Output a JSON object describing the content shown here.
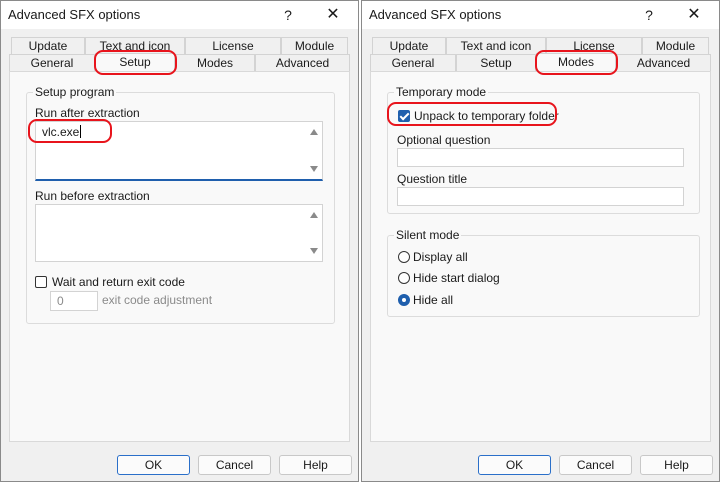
{
  "left_dialog": {
    "title": "Advanced SFX options",
    "help_label": "?",
    "close_label": "✕",
    "tabs_back": [
      "Update",
      "Text and icon",
      "License",
      "Module"
    ],
    "tabs_front": [
      "General",
      "Setup",
      "Modes",
      "Advanced"
    ],
    "selected_tab": "Setup",
    "setup_group_title": "Setup program",
    "run_after_label": "Run after extraction",
    "run_after_value": "vlc.exe",
    "run_before_label": "Run before extraction",
    "run_before_value": "",
    "wait_label": "Wait and return exit code",
    "wait_checked": false,
    "exit_code_value": "0",
    "exit_code_label": "exit code adjustment",
    "ok_label": "OK",
    "cancel_label": "Cancel",
    "help_button_label": "Help"
  },
  "right_dialog": {
    "title": "Advanced SFX options",
    "help_label": "?",
    "close_label": "✕",
    "tabs_back": [
      "Update",
      "Text and icon",
      "License",
      "Module"
    ],
    "tabs_front": [
      "General",
      "Setup",
      "Modes",
      "Advanced"
    ],
    "selected_tab": "Modes",
    "temp_group_title": "Temporary mode",
    "unpack_label": "Unpack to temporary folder",
    "unpack_checked": true,
    "optional_question_label": "Optional question",
    "optional_question_value": "",
    "question_title_label": "Question title",
    "question_title_value": "",
    "silent_group_title": "Silent mode",
    "silent_options": [
      "Display all",
      "Hide start dialog",
      "Hide all"
    ],
    "silent_selected": "Hide all",
    "ok_label": "OK",
    "cancel_label": "Cancel",
    "help_button_label": "Help"
  },
  "colors": {
    "highlight": "#e8141c",
    "accent": "#1f5fad"
  }
}
